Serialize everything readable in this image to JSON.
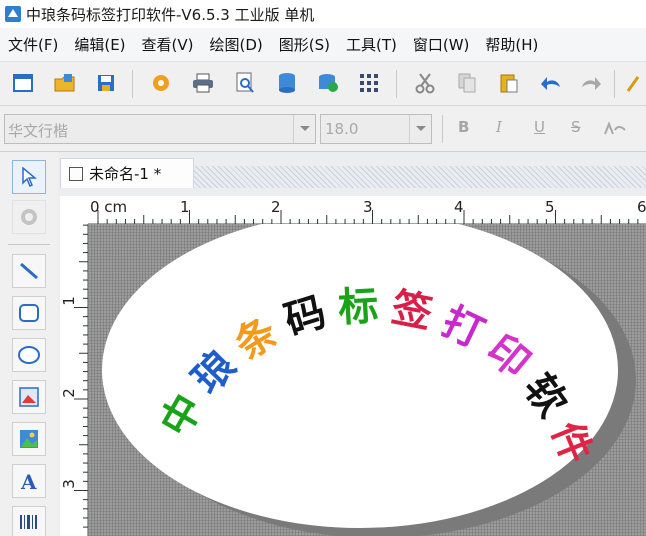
{
  "window": {
    "title": "中琅条码标签打印软件-V6.5.3 工业版 单机"
  },
  "menu": [
    "文件(F)",
    "编辑(E)",
    "查看(V)",
    "绘图(D)",
    "图形(S)",
    "工具(T)",
    "窗口(W)",
    "帮助(H)"
  ],
  "toolbar2": {
    "font_value": "华文行楷",
    "size_value": "18.0",
    "bold": "B",
    "italic": "I",
    "underline": "U",
    "strike": "S"
  },
  "document": {
    "tab_label": "未命名-1 *"
  },
  "ruler": {
    "unit": "0 cm",
    "h_ticks": [
      "1",
      "2",
      "3",
      "4",
      "5",
      "6"
    ],
    "v_ticks": [
      "1",
      "2",
      "3"
    ]
  },
  "label": {
    "chars": [
      {
        "c": "中",
        "color": "#1aa318"
      },
      {
        "c": "琅",
        "color": "#1f5ec9"
      },
      {
        "c": "条",
        "color": "#f39a1c"
      },
      {
        "c": "码",
        "color": "#111111"
      },
      {
        "c": "标",
        "color": "#1aa318"
      },
      {
        "c": "签",
        "color": "#d81f4a"
      },
      {
        "c": "打",
        "color": "#c729cf"
      },
      {
        "c": "印",
        "color": "#d632cc"
      },
      {
        "c": "软",
        "color": "#111111"
      },
      {
        "c": "件",
        "color": "#e02445"
      }
    ]
  },
  "colors": {
    "accent_blue": "#1f5ec9"
  }
}
